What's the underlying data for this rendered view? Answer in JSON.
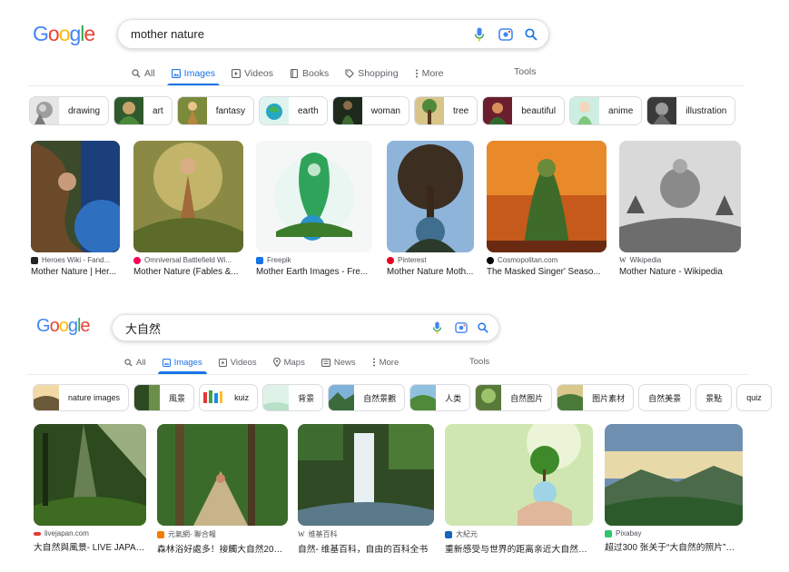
{
  "colors": {
    "accent": "#1a73e8",
    "google_blue": "#4285F4",
    "google_red": "#EA4335",
    "google_yellow": "#FBBC05",
    "google_green": "#34A853"
  },
  "panel1": {
    "logo": [
      "G",
      "o",
      "o",
      "g",
      "l",
      "e"
    ],
    "query": "mother nature",
    "tabs": [
      {
        "label": "All",
        "icon": "search-icon"
      },
      {
        "label": "Images",
        "icon": "image-icon",
        "active": true
      },
      {
        "label": "Videos",
        "icon": "play-icon"
      },
      {
        "label": "Books",
        "icon": "book-icon"
      },
      {
        "label": "Shopping",
        "icon": "tag-icon"
      },
      {
        "label": "More",
        "icon": "dots-vertical-icon"
      }
    ],
    "tools": "Tools",
    "chips": [
      "drawing",
      "art",
      "fantasy",
      "earth",
      "woman",
      "tree",
      "beautiful",
      "anime",
      "illustration"
    ],
    "results": [
      {
        "source": "Heroes Wiki - Fand...",
        "title": "Mother Nature | Her..."
      },
      {
        "source": "Omniversal Battlefield Wi...",
        "title": "Mother Nature (Fables &..."
      },
      {
        "source": "Freepik",
        "title": "Mother Earth Images - Fre..."
      },
      {
        "source": "Pinterest",
        "title": "Mother Nature Moth..."
      },
      {
        "source": "Cosmopolitan.com",
        "title": "The Masked Singer' Seaso..."
      },
      {
        "source": "Wikipedia",
        "title": "Mother Nature - Wikipedia"
      }
    ]
  },
  "panel2": {
    "logo": [
      "G",
      "o",
      "o",
      "g",
      "l",
      "e"
    ],
    "query": "大自然",
    "tabs": [
      {
        "label": "All",
        "icon": "search-icon"
      },
      {
        "label": "Images",
        "icon": "image-icon",
        "active": true
      },
      {
        "label": "Videos",
        "icon": "play-icon"
      },
      {
        "label": "Maps",
        "icon": "map-pin-icon"
      },
      {
        "label": "News",
        "icon": "news-icon"
      },
      {
        "label": "More",
        "icon": "dots-vertical-icon"
      }
    ],
    "tools": "Tools",
    "chips": [
      "nature images",
      "風景",
      "kuiz",
      "背景",
      "自然景觀",
      "人类",
      "自然图片",
      "图片素材",
      "自然美景",
      "景點",
      "quiz"
    ],
    "results": [
      {
        "source": "livejapan.com",
        "title": "大自然與風景- LIVE JAPAN (..."
      },
      {
        "source": "元氣網- 聯合報",
        "title": "森林浴好處多！接觸大自然20分鐘..."
      },
      {
        "source": "维基百科",
        "title": "自然- 维基百科，自由的百科全书"
      },
      {
        "source": "大紀元",
        "title": "重新感受与世界的距离亲近大自然好处..."
      },
      {
        "source": "Pixabay",
        "title": "超过300 张关于“大自然的照片”和“照..."
      }
    ]
  }
}
